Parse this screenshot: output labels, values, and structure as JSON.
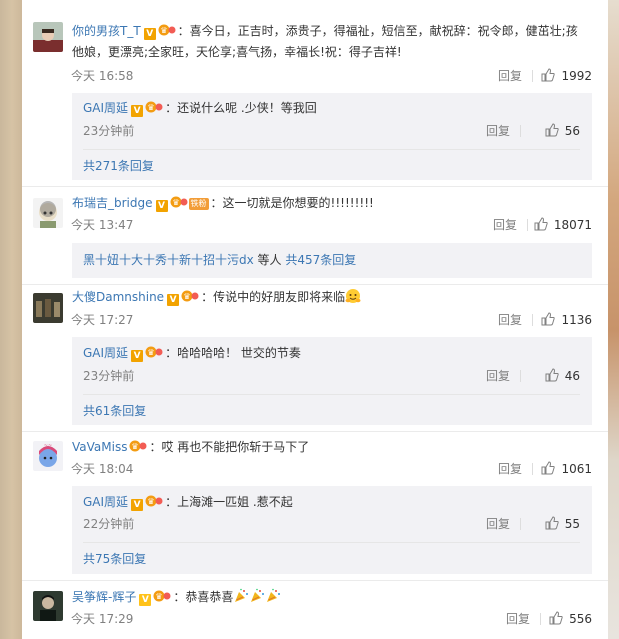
{
  "comments": [
    {
      "user": "你的男孩T_T",
      "text": "喜今日，正吉时，添贵子，得福祉，短信至，献祝辞：祝令郎，健茁壮;孩他娘，更漂亮;全家旺，天伦享;喜气扬，幸福长!祝：得子吉祥!",
      "time": "今天 16:58",
      "reply": "回复",
      "likes": "1992",
      "sub": {
        "user": "GAI周延",
        "text": "还说什么呢 .少侠！等我回",
        "time": "23分钟前",
        "reply": "回复",
        "likes": "56",
        "more": "共271条回复"
      }
    },
    {
      "user": "布瑞吉_bridge",
      "fan_badge": "铁粉",
      "text": "这一切就是你想要的!!!!!!!!!",
      "time": "今天 13:47",
      "reply": "回复",
      "likes": "18071",
      "sub_summary": {
        "names": "黑十妞十大十秀十新十招十污dx",
        "suffix": " 等人 ",
        "count": "共457条回复"
      }
    },
    {
      "user": "大傻Damnshine",
      "text": "传说中的好朋友即将来临",
      "time": "今天 17:27",
      "reply": "回复",
      "likes": "1136",
      "sub": {
        "user": "GAI周延",
        "text": "哈哈哈哈！ 世交的节奏",
        "time": "23分钟前",
        "reply": "回复",
        "likes": "46",
        "more": "共61条回复"
      }
    },
    {
      "user": "VaVaMiss",
      "text": "哎 再也不能把你斩于马下了",
      "time": "今天 18:04",
      "reply": "回复",
      "likes": "1061",
      "sub": {
        "user": "GAI周延",
        "text": "上海滩一匹姐 .惹不起",
        "time": "22分钟前",
        "reply": "回复",
        "likes": "55",
        "more": "共75条回复"
      }
    },
    {
      "user": "吴筝辉-辉子",
      "text": "恭喜恭喜",
      "time": "今天 17:29",
      "reply": "回复",
      "likes": "556"
    }
  ],
  "badges": {
    "verified": "V"
  },
  "icons": {
    "verified": "verified-v-icon",
    "vip": "vip-crown-icon",
    "like": "thumbs-up-icon",
    "emoji_hug": "hug-emoji-icon",
    "emoji_celebrate": "party-popper-emoji-icon"
  },
  "colors": {
    "username_orange": "#eb7350",
    "username_blue": "#3c77b3",
    "meta_gray": "#808080",
    "sub_background": "#f2f2f5"
  }
}
